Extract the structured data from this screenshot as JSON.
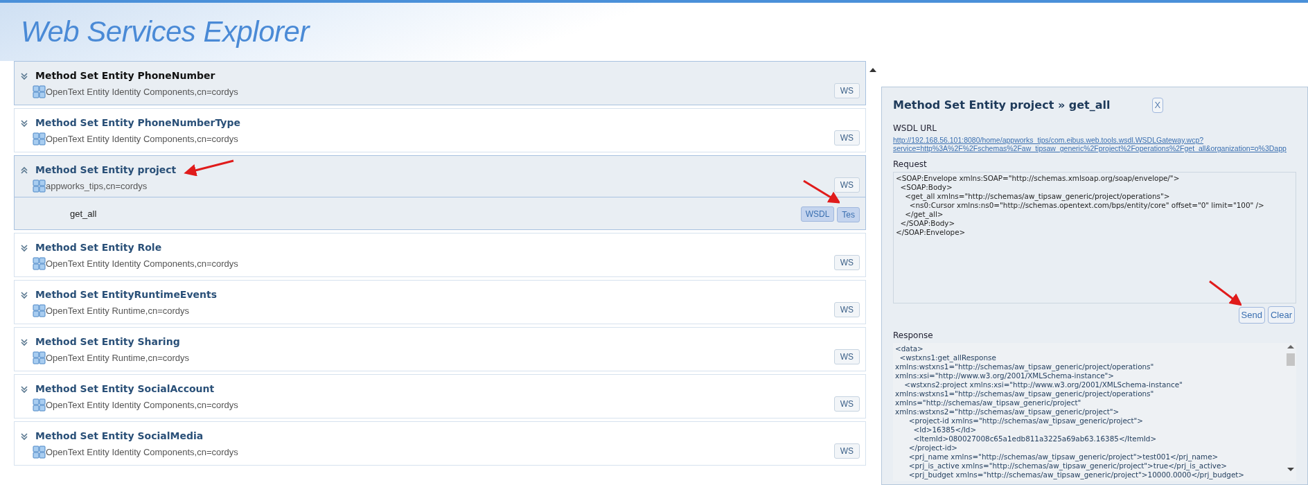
{
  "page_title": "Web Services Explorer",
  "method_sets": [
    {
      "title": "Method Set Entity PhoneNumber",
      "subtitle": "OpenText Entity Identity Components,cn=cordys",
      "wsdl_button": "WS",
      "selected": true,
      "expanded": false
    },
    {
      "title": "Method Set Entity PhoneNumberType",
      "subtitle": "OpenText Entity Identity Components,cn=cordys",
      "wsdl_button": "WS",
      "selected": false,
      "expanded": false
    },
    {
      "title": "Method Set Entity project",
      "subtitle": "appworks_tips,cn=cordys",
      "wsdl_button": "WS",
      "selected": false,
      "expanded": true,
      "annotated": true,
      "methods": [
        {
          "name": "get_all",
          "wsdl_button": "WSDL",
          "test_button": "Tes",
          "annotated": true
        }
      ]
    },
    {
      "title": "Method Set Entity Role",
      "subtitle": "OpenText Entity Identity Components,cn=cordys",
      "wsdl_button": "WS",
      "selected": false,
      "expanded": false
    },
    {
      "title": "Method Set EntityRuntimeEvents",
      "subtitle": "OpenText Entity Runtime,cn=cordys",
      "wsdl_button": "WS",
      "selected": false,
      "expanded": false
    },
    {
      "title": "Method Set Entity Sharing",
      "subtitle": "OpenText Entity Runtime,cn=cordys",
      "wsdl_button": "WS",
      "selected": false,
      "expanded": false
    },
    {
      "title": "Method Set Entity SocialAccount",
      "subtitle": "OpenText Entity Identity Components,cn=cordys",
      "wsdl_button": "WS",
      "selected": false,
      "expanded": false
    },
    {
      "title": "Method Set Entity SocialMedia",
      "subtitle": "OpenText Entity Identity Components,cn=cordys",
      "wsdl_button": "WS",
      "selected": false,
      "expanded": false
    }
  ],
  "test_panel": {
    "title": "Method Set Entity project » get_all",
    "close_button": "X",
    "wsdl_url_label": "WSDL URL",
    "wsdl_url_lines": [
      "http://192.168.56.101:8080/home/appworks_tips/com.eibus.web.tools.wsdl.WSDLGateway.wcp?",
      "service=http%3A%2F%2Fschemas%2Faw_tipsaw_generic%2Fproject%2Foperations%2Fget_all&organization=o%3Dapp"
    ],
    "request_label": "Request",
    "request_lines": [
      "<SOAP:Envelope xmlns:SOAP=\"http://schemas.xmlsoap.org/soap/envelope/\">",
      "  <SOAP:Body>",
      "    <get_all xmlns=\"http://schemas/aw_tipsaw_generic/project/operations\">",
      "      <ns0:Cursor xmlns:ns0=\"http://schemas.opentext.com/bps/entity/core\" offset=\"0\" limit=\"100\" />",
      "    </get_all>",
      "  </SOAP:Body>",
      "</SOAP:Envelope>"
    ],
    "send_button": "Send",
    "send_annotated": true,
    "clear_button": "Clear",
    "response_label": "Response",
    "response_lines": [
      "<data>",
      "  <wstxns1:get_allResponse",
      "xmlns:wstxns1=\"http://schemas/aw_tipsaw_generic/project/operations\"",
      "xmlns:xsi=\"http://www.w3.org/2001/XMLSchema-instance\">",
      "    <wstxns2:project xmlns:xsi=\"http://www.w3.org/2001/XMLSchema-instance\"",
      "xmlns:wstxns1=\"http://schemas/aw_tipsaw_generic/project/operations\"",
      "xmlns=\"http://schemas/aw_tipsaw_generic/project\"",
      "xmlns:wstxns2=\"http://schemas/aw_tipsaw_generic/project\">",
      "      <project-id xmlns=\"http://schemas/aw_tipsaw_generic/project\">",
      "        <Id>16385</Id>",
      "        <ItemId>080027008c65a1edb811a3225a69ab63.16385</ItemId>",
      "      </project-id>",
      "      <prj_name xmlns=\"http://schemas/aw_tipsaw_generic/project\">test001</prj_name>",
      "      <prj_is_active xmlns=\"http://schemas/aw_tipsaw_generic/project\">true</prj_is_active>",
      "      <prj_budget xmlns=\"http://schemas/aw_tipsaw_generic/project\">10000.0000</prj_budget>"
    ]
  }
}
